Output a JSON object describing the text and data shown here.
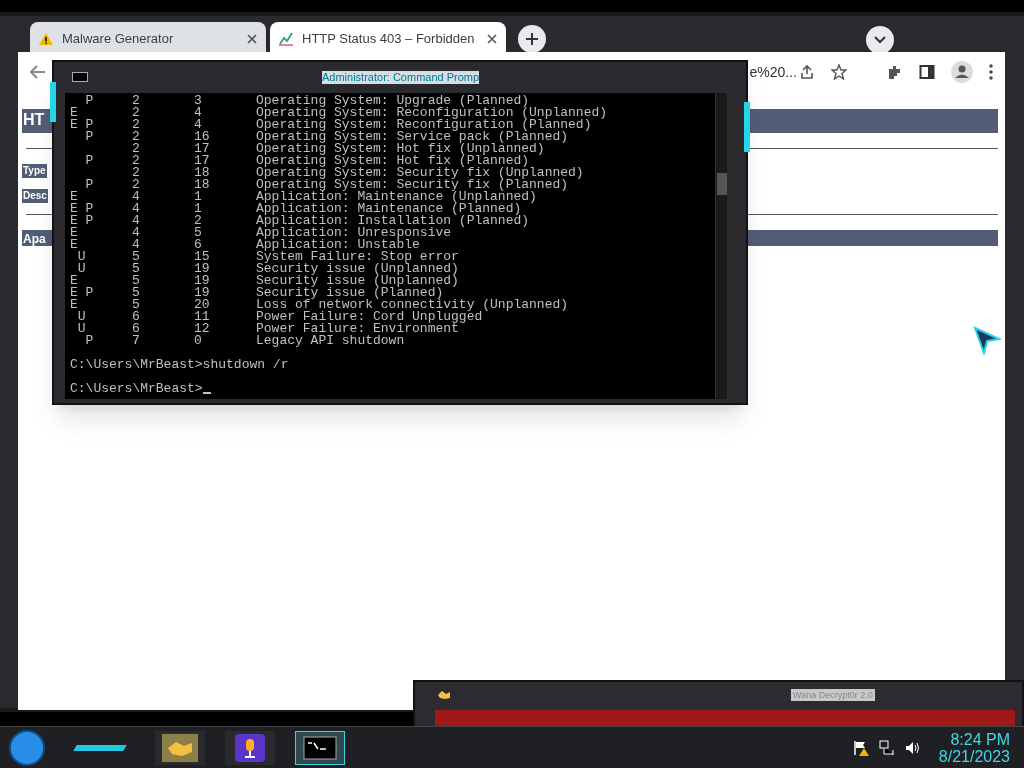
{
  "browser": {
    "tabs": [
      {
        "title": "Malware Generator",
        "selected": false,
        "kind": "warning"
      },
      {
        "title": "HTTP Status 403 – Forbidden",
        "selected": true,
        "kind": "chart"
      }
    ],
    "address_fragment": "e%20...",
    "page_fragments": [
      {
        "kind": "heading",
        "text": "HT"
      },
      {
        "kind": "label",
        "text": "Type"
      },
      {
        "kind": "label",
        "text": "Desc"
      },
      {
        "kind": "footer",
        "text": "Apa"
      }
    ]
  },
  "console": {
    "title": "Administrator: Command Promp",
    "rows": [
      {
        "flags": "  P",
        "major": "2",
        "minor": "3",
        "description": "Operating System: Upgrade (Planned)"
      },
      {
        "flags": "E",
        "major": "2",
        "minor": "4",
        "description": "Operating System: Reconfiguration (Unplanned)"
      },
      {
        "flags": "E P",
        "major": "2",
        "minor": "4",
        "description": "Operating System: Reconfiguration (Planned)"
      },
      {
        "flags": "  P",
        "major": "2",
        "minor": "16",
        "description": "Operating System: Service pack (Planned)"
      },
      {
        "flags": "",
        "major": "2",
        "minor": "17",
        "description": "Operating System: Hot fix (Unplanned)"
      },
      {
        "flags": "  P",
        "major": "2",
        "minor": "17",
        "description": "Operating System: Hot fix (Planned)"
      },
      {
        "flags": "",
        "major": "2",
        "minor": "18",
        "description": "Operating System: Security fix (Unplanned)"
      },
      {
        "flags": "  P",
        "major": "2",
        "minor": "18",
        "description": "Operating System: Security fix (Planned)"
      },
      {
        "flags": "E",
        "major": "4",
        "minor": "1",
        "description": "Application: Maintenance (Unplanned)"
      },
      {
        "flags": "E P",
        "major": "4",
        "minor": "1",
        "description": "Application: Maintenance (Planned)"
      },
      {
        "flags": "E P",
        "major": "4",
        "minor": "2",
        "description": "Application: Installation (Planned)"
      },
      {
        "flags": "E",
        "major": "4",
        "minor": "5",
        "description": "Application: Unresponsive"
      },
      {
        "flags": "E",
        "major": "4",
        "minor": "6",
        "description": "Application: Unstable"
      },
      {
        "flags": " U",
        "major": "5",
        "minor": "15",
        "description": "System Failure: Stop error"
      },
      {
        "flags": " U",
        "major": "5",
        "minor": "19",
        "description": "Security issue (Unplanned)"
      },
      {
        "flags": "E",
        "major": "5",
        "minor": "19",
        "description": "Security issue (Unplanned)"
      },
      {
        "flags": "E P",
        "major": "5",
        "minor": "19",
        "description": "Security issue (Planned)"
      },
      {
        "flags": "E",
        "major": "5",
        "minor": "20",
        "description": "Loss of network connectivity (Unplanned)"
      },
      {
        "flags": " U",
        "major": "6",
        "minor": "11",
        "description": "Power Failure: Cord Unplugged"
      },
      {
        "flags": " U",
        "major": "6",
        "minor": "12",
        "description": "Power Failure: Environment"
      },
      {
        "flags": "  P",
        "major": "7",
        "minor": "0",
        "description": "Legacy API shutdown"
      }
    ],
    "lines": [
      "C:\\Users\\MrBeast>shutdown /r",
      "C:\\Users\\MrBeast>"
    ]
  },
  "background_window": {
    "title": "Wana Decrypt0r 2.0"
  },
  "taskbar": {
    "apps": [
      {
        "kind": "handshake",
        "selected": false
      },
      {
        "kind": "microphone",
        "selected": false
      },
      {
        "kind": "console",
        "selected": true
      }
    ],
    "time": "8:24 PM",
    "date": "8/21/2023"
  }
}
